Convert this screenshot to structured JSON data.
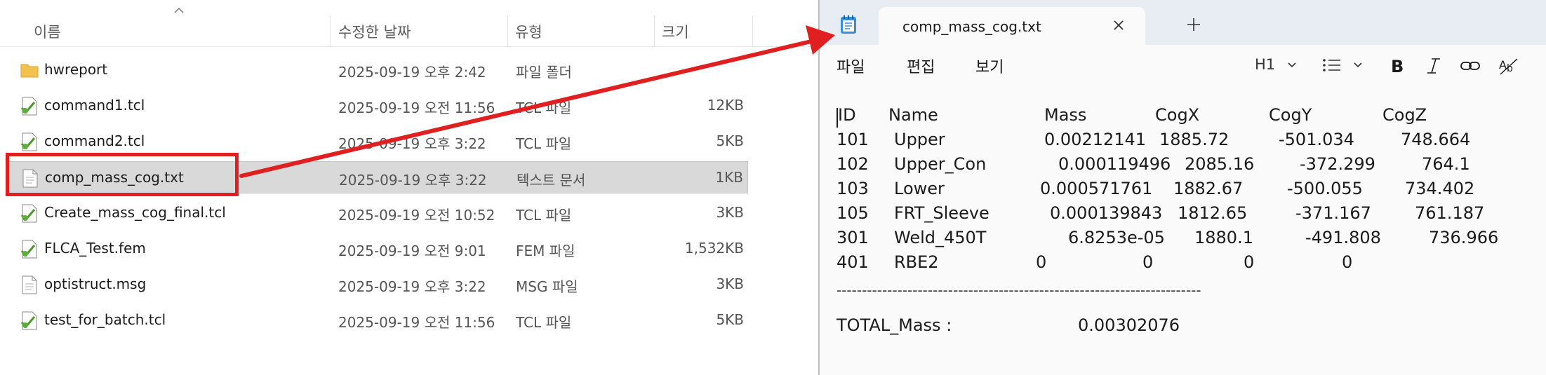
{
  "explorer": {
    "columns": {
      "name": "이름",
      "modified": "수정한 날짜",
      "type": "유형",
      "size": "크기"
    },
    "files": [
      {
        "name": "hwreport",
        "modified": "2025-09-19 오후 2:42",
        "type": "파일 폴더",
        "size": "",
        "icon": "folder-icon"
      },
      {
        "name": "command1.tcl",
        "modified": "2025-09-19 오전 11:56",
        "type": "TCL 파일",
        "size": "12KB",
        "icon": "tcl-file-icon"
      },
      {
        "name": "command2.tcl",
        "modified": "2025-09-19 오후 3:22",
        "type": "TCL 파일",
        "size": "5KB",
        "icon": "tcl-file-icon"
      },
      {
        "name": "comp_mass_cog.txt",
        "modified": "2025-09-19 오후 3:22",
        "type": "텍스트 문서",
        "size": "1KB",
        "icon": "text-file-icon",
        "selected": true
      },
      {
        "name": "Create_mass_cog_final.tcl",
        "modified": "2025-09-19 오전 10:52",
        "type": "TCL 파일",
        "size": "3KB",
        "icon": "tcl-file-icon"
      },
      {
        "name": "FLCA_Test.fem",
        "modified": "2025-09-19 오전 9:01",
        "type": "FEM 파일",
        "size": "1,532KB",
        "icon": "tcl-file-icon"
      },
      {
        "name": "optistruct.msg",
        "modified": "2025-09-19 오후 3:22",
        "type": "MSG 파일",
        "size": "3KB",
        "icon": "text-file-icon"
      },
      {
        "name": "test_for_batch.tcl",
        "modified": "2025-09-19 오전 11:56",
        "type": "TCL 파일",
        "size": "5KB",
        "icon": "tcl-file-icon"
      }
    ]
  },
  "notepad": {
    "tab_title": "comp_mass_cog.txt",
    "menu": {
      "file": "파일",
      "edit": "편집",
      "view": "보기"
    },
    "toolbar": {
      "heading": "H1"
    },
    "content": {
      "header": [
        "ID",
        "Name",
        "Mass",
        "CogX",
        "CogY",
        "CogZ"
      ],
      "rows": [
        [
          "101",
          "Upper",
          "0.00212141",
          "1885.72",
          "-501.034",
          "748.664"
        ],
        [
          "102",
          "Upper_Con",
          "0.000119496",
          "2085.16",
          "-372.299",
          "764.1"
        ],
        [
          "103",
          "Lower",
          "0.000571761",
          "1882.67",
          "-500.055",
          "734.402"
        ],
        [
          "105",
          "FRT_Sleeve",
          "0.000139843",
          "1812.65",
          "-371.167",
          "761.187"
        ],
        [
          "301",
          "Weld_450T",
          "6.8253e-05",
          "1880.1",
          "-491.808",
          "736.966"
        ],
        [
          "401",
          "RBE2",
          "0",
          "0",
          "0",
          "0"
        ]
      ],
      "separator": "------------------------------------------------------------------------",
      "total_label": "TOTAL_Mass :",
      "total_value": "0.00302076"
    }
  },
  "colors": {
    "highlight": "#e02020",
    "selected_row": "#d9d9d9",
    "titlebar": "#e8edf3",
    "folder": "#f2c14e"
  }
}
